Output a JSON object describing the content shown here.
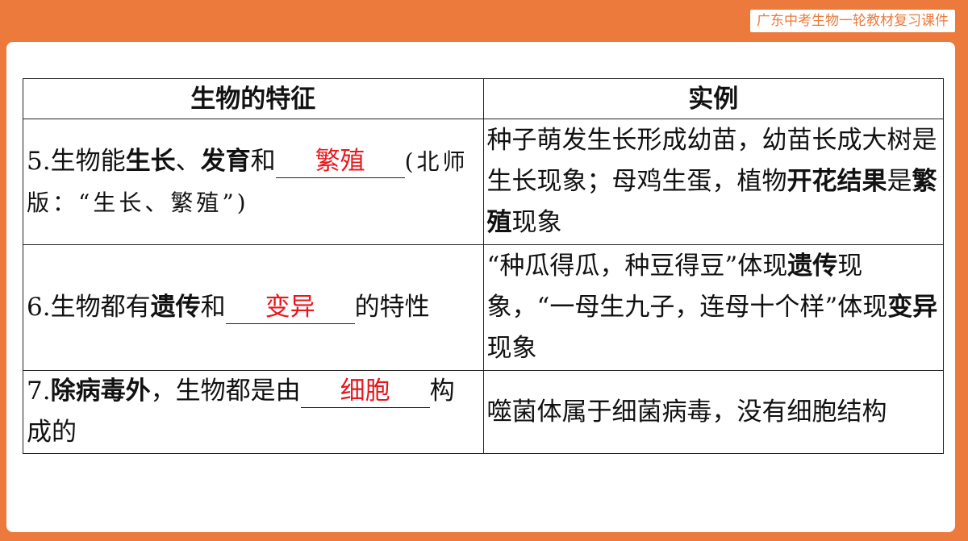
{
  "header": {
    "badge": "广东中考生物一轮教材复习课件"
  },
  "table": {
    "headers": [
      "生物的特征",
      "实例"
    ],
    "rows": [
      {
        "feature": {
          "prefix": "5.生物能",
          "bold1": "生长",
          "sep": "、",
          "bold2": "发育",
          "mid": "和",
          "answer": "繁殖",
          "note": "(北师版：“生长、繁殖”)"
        },
        "example": {
          "t1": "种子萌发生长形成幼苗，幼苗长成大树是生长现象；母鸡生蛋，植物",
          "b1": "开花结果",
          "t2": "是",
          "b2": "繁殖",
          "t3": "现象"
        }
      },
      {
        "feature": {
          "prefix": "6.生物都有",
          "bold1": "遗传",
          "mid": "和",
          "answer": "变异",
          "suffix": "的特性"
        },
        "example": {
          "t1": "“种瓜得瓜，种豆得豆”体现",
          "b1": "遗传",
          "t2": "现象，“一母生九子，连母十个样”体现",
          "b2": "变异",
          "t3": "现象"
        }
      },
      {
        "feature": {
          "prefix": "7.",
          "bold1": "除病毒外",
          "mid": "，生物都是由",
          "answer": "细胞",
          "suffix": "构成的"
        },
        "example": {
          "t1": "噬菌体属于细菌病毒，没有细胞结构"
        }
      }
    ]
  }
}
